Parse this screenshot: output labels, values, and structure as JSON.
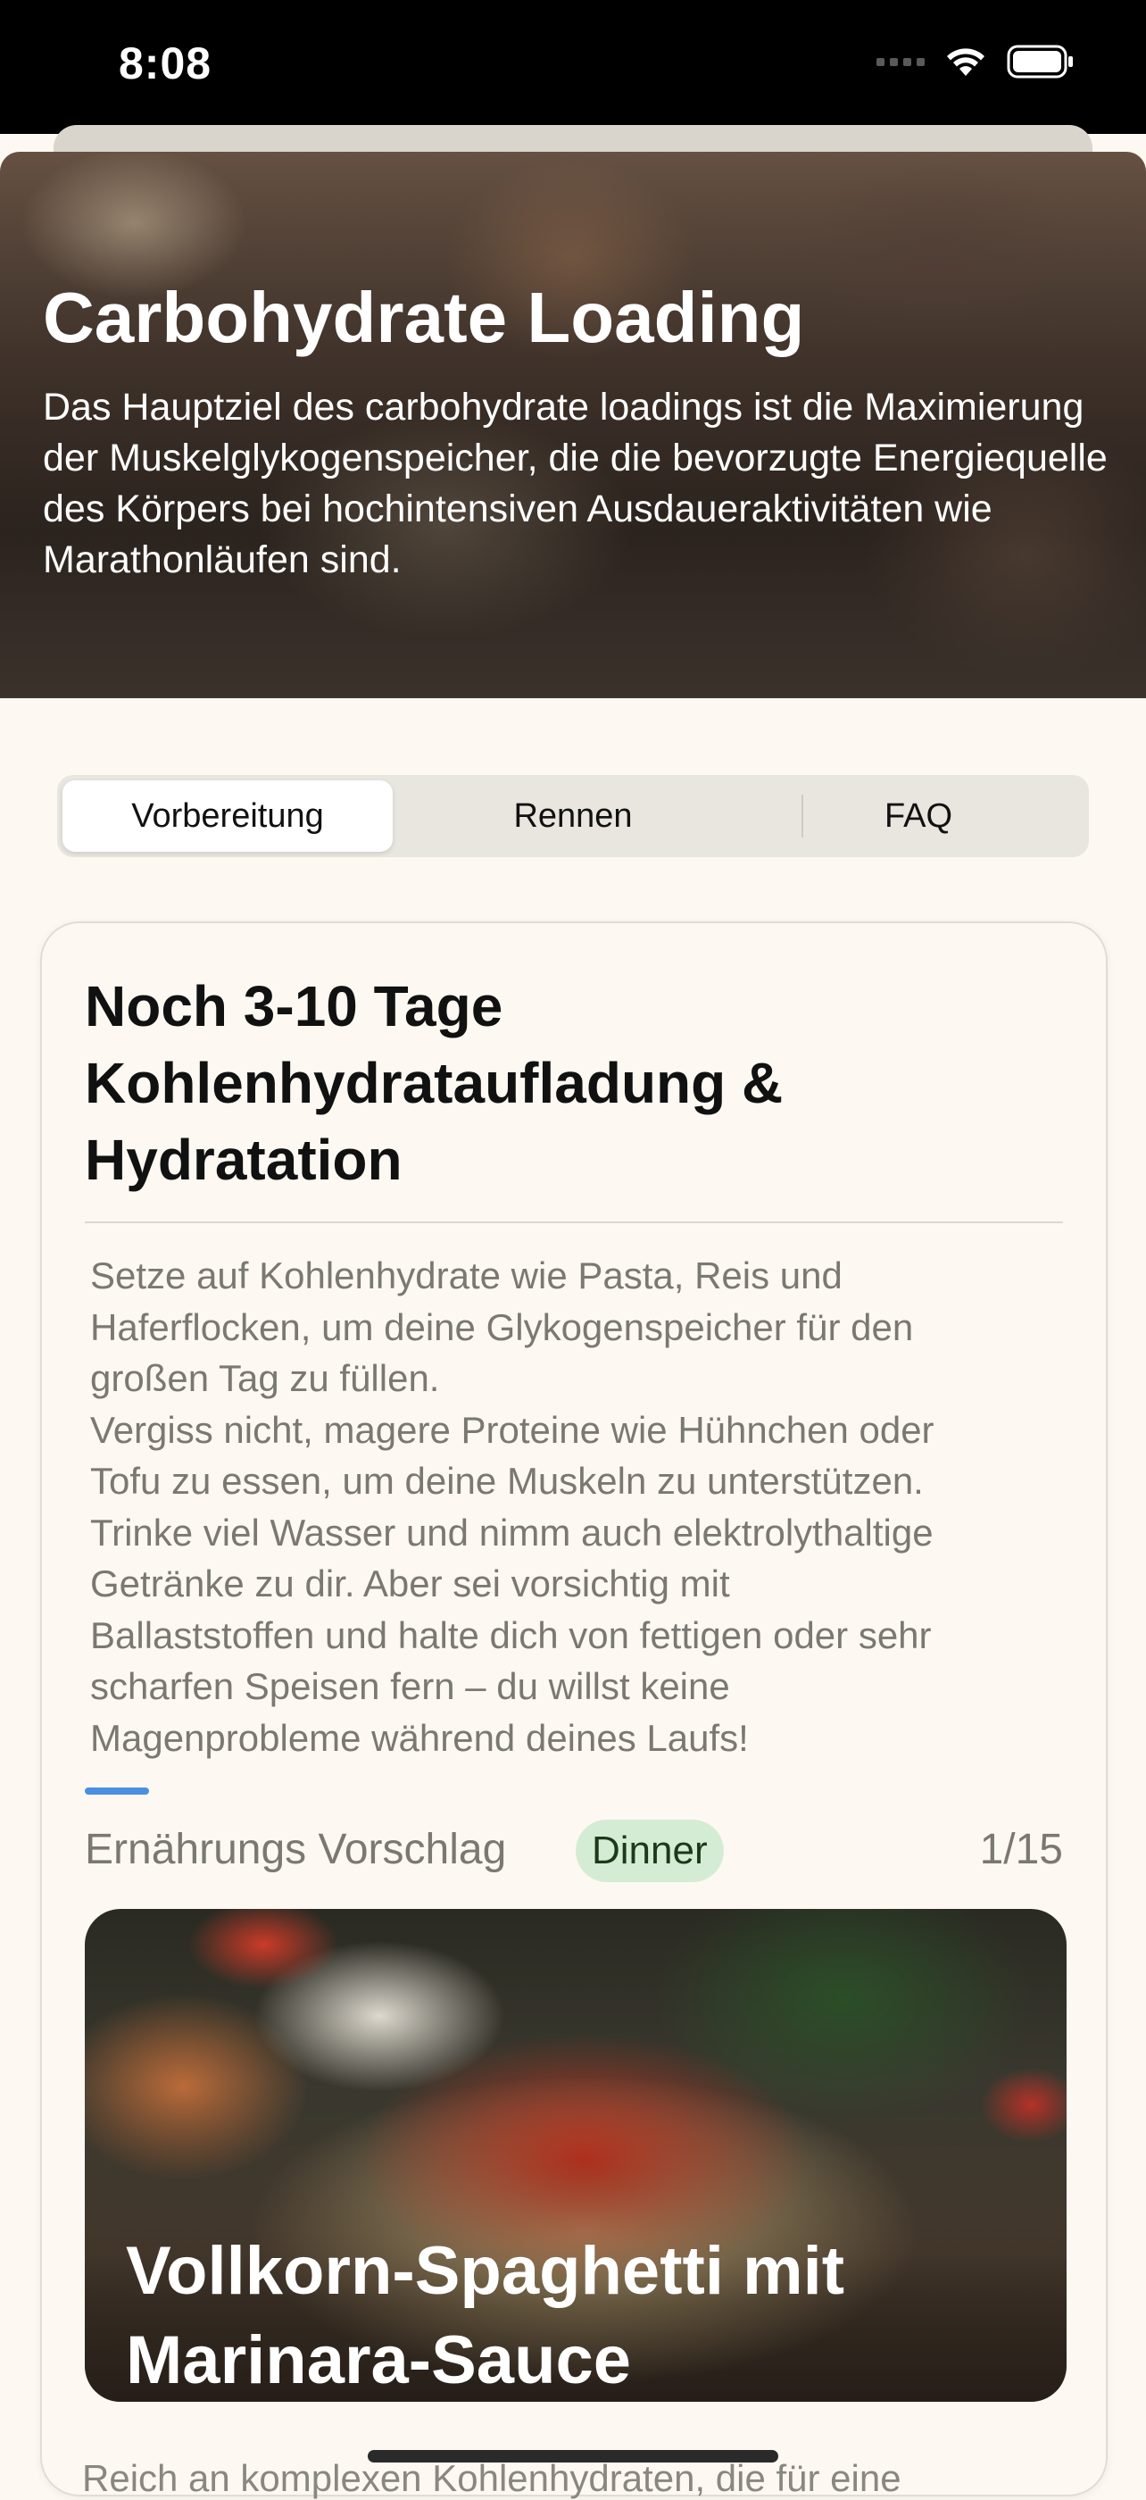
{
  "status_bar": {
    "time": "8:08"
  },
  "hero": {
    "title": "Carbohydrate Loading",
    "description": "Das Hauptziel des carbohydrate loadings ist die Maximierung der Muskelglykogenspeicher, die die bevorzugte Energiequelle des Körpers bei hochintensiven Ausdaueraktivitäten wie Marathonläufen sind."
  },
  "tabs": [
    {
      "label": "Vorbereitung",
      "selected": true
    },
    {
      "label": "Rennen",
      "selected": false
    },
    {
      "label": "FAQ",
      "selected": false
    }
  ],
  "card": {
    "title": "Noch 3-10 Tage Kohlenhydrataufladung & Hydratation",
    "body_lines": [
      "Setze auf Kohlenhydrate wie Pasta, Reis und",
      "Haferflocken, um deine Glykogenspeicher für den",
      "großen Tag zu füllen.",
      "Vergiss nicht, magere Proteine wie Hühnchen oder",
      "Tofu zu essen, um deine Muskeln zu unterstützen.",
      "Trinke viel Wasser und nimm auch elektrolythaltige",
      "Getränke zu dir. Aber sei vorsichtig mit",
      "Ballaststoffen und halte dich von fettigen oder sehr",
      "scharfen Speisen fern – du willst keine",
      "Magenprobleme während deines Laufs!"
    ],
    "suggestion_label": "Ernährungs Vorschlag",
    "meal_type": "Dinner",
    "page_counter": "1/15",
    "recipe_title": "Vollkorn-Spaghetti mit Marinara-Sauce",
    "recipe_desc_partial": "Reich an komplexen Kohlenhydraten, die für eine"
  },
  "colors": {
    "background": "#fdf9f2",
    "accent_blue": "#4a90e2",
    "badge_green": "#d5ecd4"
  }
}
